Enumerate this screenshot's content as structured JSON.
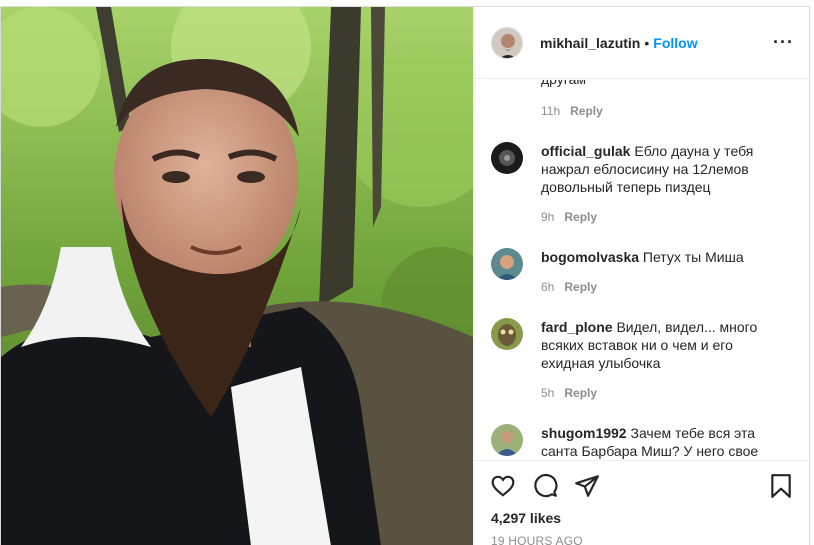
{
  "header": {
    "username": "mikhail_lazutin",
    "separator": "•",
    "follow_label": "Follow",
    "more_label": "···"
  },
  "comments": {
    "truncated_text": "другам",
    "first_time": "11h",
    "reply_label": "Reply",
    "items": [
      {
        "user": "official_gulak",
        "text": "Ебло дауна у тебя нажрал еблосисину на 12лемов довольный теперь пиздец",
        "time": "9h"
      },
      {
        "user": "bogomolvaska",
        "text": "Петух ты Миша",
        "time": "6h"
      },
      {
        "user": "fard_plone",
        "text": "Видел, видел... много всяких вставок ни о чем и его ехидная улыбочка",
        "time": "5h"
      },
      {
        "user": "shugom1992",
        "text": "Зачем тебе вся эта санта Барбара Миш? У него свое",
        "time": ""
      }
    ]
  },
  "footer": {
    "likes": "4,297 likes",
    "posted": "19 HOURS AGO"
  },
  "icons": {
    "like": "heart-icon",
    "comment": "comment-icon",
    "share": "share-icon",
    "save": "bookmark-icon"
  },
  "colors": {
    "accent": "#0095f6",
    "muted": "#8e8e8e",
    "text": "#262626"
  }
}
